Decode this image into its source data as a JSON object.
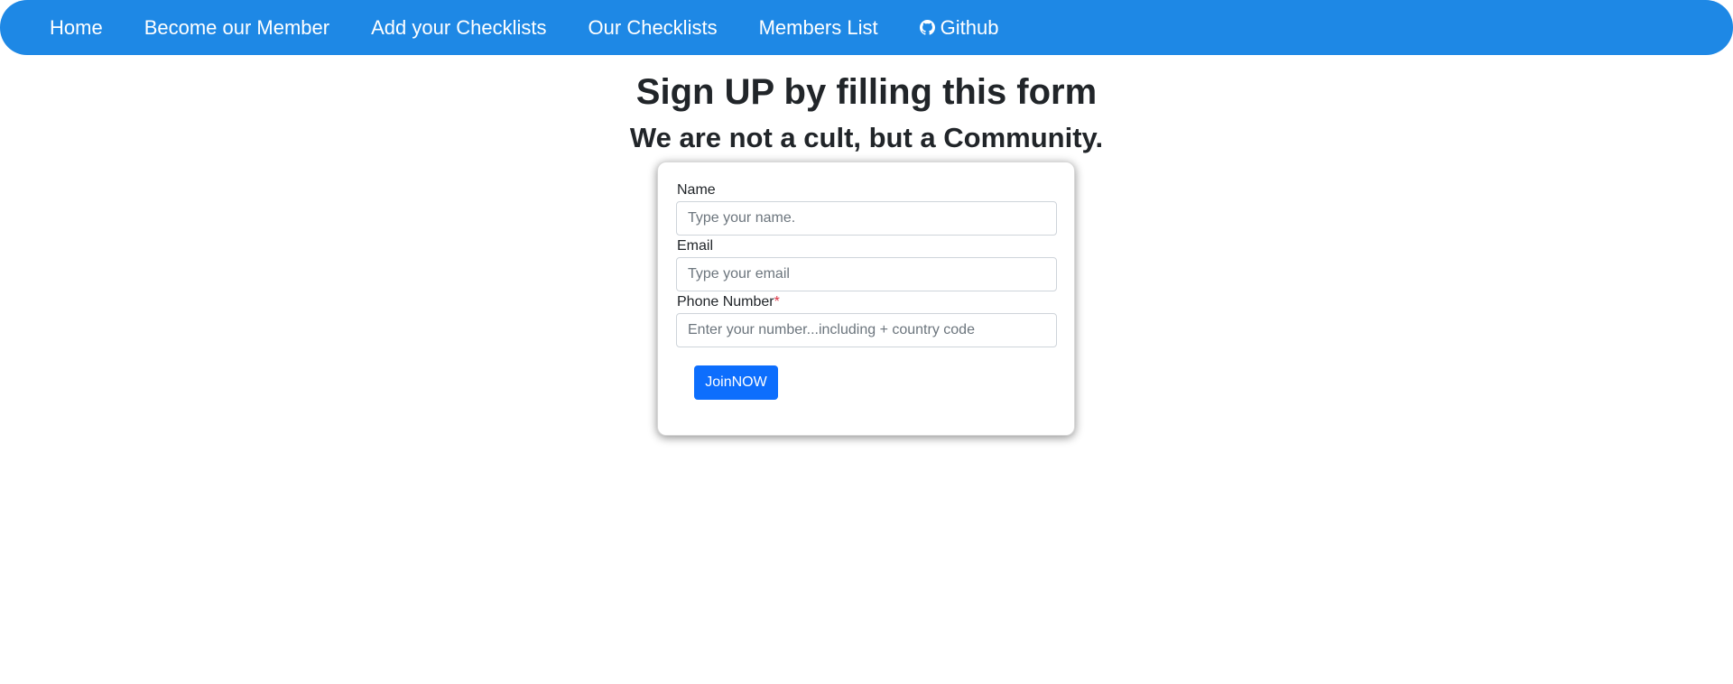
{
  "nav": {
    "items": [
      {
        "label": "Home"
      },
      {
        "label": "Become our Member"
      },
      {
        "label": "Add your Checklists"
      },
      {
        "label": "Our Checklists"
      },
      {
        "label": "Members List"
      },
      {
        "label": "Github",
        "icon": "github-icon"
      }
    ],
    "background_color": "#1e88e5"
  },
  "header": {
    "title": "Sign UP by filling this form",
    "subtitle": "We are not a cult, but a Community."
  },
  "form": {
    "name": {
      "label": "Name",
      "value": "",
      "placeholder": "Type your name."
    },
    "email": {
      "label": "Email",
      "value": "",
      "placeholder": "Type your email"
    },
    "phone": {
      "label": "Phone Number",
      "required_mark": "*",
      "value": "",
      "placeholder": "Enter your number...including + country code"
    },
    "submit_label": "JoinNOW",
    "button_color": "#0d6efd"
  }
}
